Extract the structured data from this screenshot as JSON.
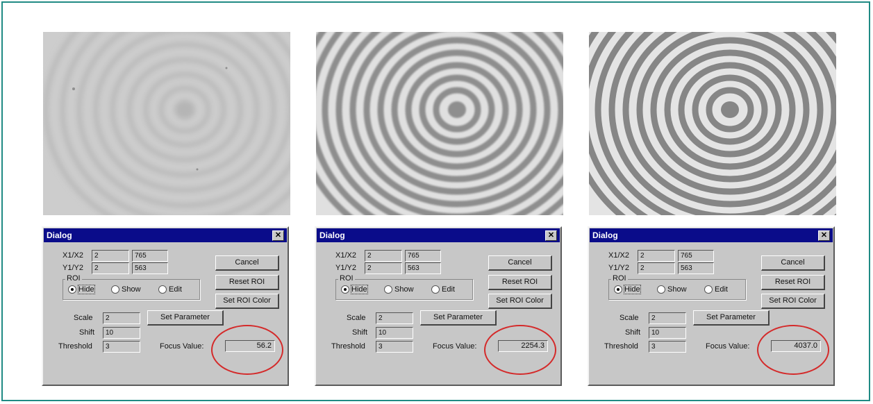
{
  "dialogs": [
    {
      "title": "Dialog",
      "x_label": "X1/X2",
      "x1": "2",
      "x2": "765",
      "y_label": "Y1/Y2",
      "y1": "2",
      "y2": "563",
      "roi_label": "ROI",
      "roi_options": [
        "Hide",
        "Show",
        "Edit"
      ],
      "roi_selected": "Hide",
      "scale_label": "Scale",
      "scale": "2",
      "shift_label": "Shift",
      "shift": "10",
      "threshold_label": "Threshold",
      "threshold": "3",
      "cancel_label": "Cancel",
      "reset_roi_label": "Reset ROI",
      "set_roi_color_label": "Set ROI Color",
      "set_parameter_label": "Set Parameter",
      "focus_label": "Focus Value:",
      "focus_value": "56.2"
    },
    {
      "title": "Dialog",
      "x_label": "X1/X2",
      "x1": "2",
      "x2": "765",
      "y_label": "Y1/Y2",
      "y1": "2",
      "y2": "563",
      "roi_label": "ROI",
      "roi_options": [
        "Hide",
        "Show",
        "Edit"
      ],
      "roi_selected": "Hide",
      "scale_label": "Scale",
      "scale": "2",
      "shift_label": "Shift",
      "shift": "10",
      "threshold_label": "Threshold",
      "threshold": "3",
      "cancel_label": "Cancel",
      "reset_roi_label": "Reset ROI",
      "set_roi_color_label": "Set ROI Color",
      "set_parameter_label": "Set Parameter",
      "focus_label": "Focus Value:",
      "focus_value": "2254.3"
    },
    {
      "title": "Dialog",
      "x_label": "X1/X2",
      "x1": "2",
      "x2": "765",
      "y_label": "Y1/Y2",
      "y1": "2",
      "y2": "563",
      "roi_label": "ROI",
      "roi_options": [
        "Hide",
        "Show",
        "Edit"
      ],
      "roi_selected": "Hide",
      "scale_label": "Scale",
      "scale": "2",
      "shift_label": "Shift",
      "shift": "10",
      "threshold_label": "Threshold",
      "threshold": "3",
      "cancel_label": "Cancel",
      "reset_roi_label": "Reset ROI",
      "set_roi_color_label": "Set ROI Color",
      "set_parameter_label": "Set Parameter",
      "focus_label": "Focus Value:",
      "focus_value": "4037.0"
    }
  ],
  "images": [
    {
      "focus": "blurred"
    },
    {
      "focus": "partially-focused"
    },
    {
      "focus": "sharp"
    }
  ],
  "colors": {
    "frame": "#1f8a84",
    "title_bar": "#0a0c8a",
    "dialog_bg": "#c7c7c7",
    "highlight_ellipse": "#d42a2a"
  }
}
